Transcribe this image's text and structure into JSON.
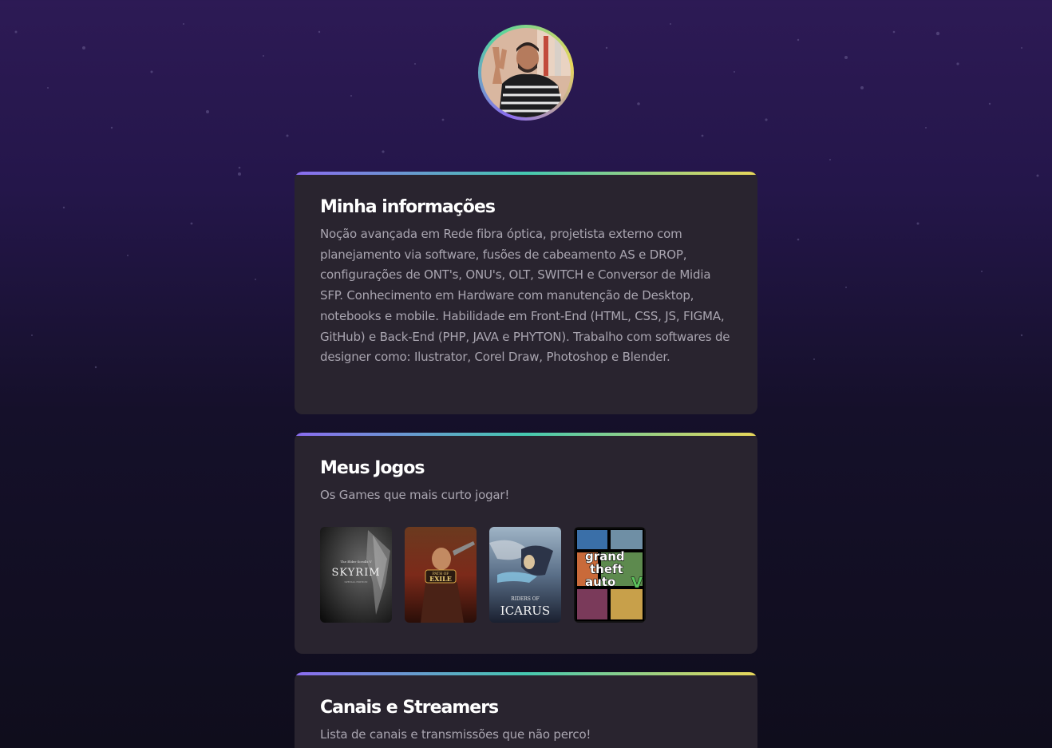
{
  "profile": {
    "avatar_icon": "profile-photo"
  },
  "info_card": {
    "title": "Minha informações",
    "text": "Noção avançada em Rede fibra óptica, projetista externo com planejamento via software, fusões de cabeamento AS e DROP, configurações de ONT's, ONU's, OLT, SWITCH e Conversor de Midia SFP. Conhecimento em Hardware com manutenção de Desktop, notebooks e mobile. Habilidade em Front-End (HTML, CSS, JS, FIGMA, GitHub) e Back-End (PHP, JAVA e PHYTON). Trabalho com softwares de designer como: Ilustrator, Corel Draw, Photoshop e Blender."
  },
  "games_card": {
    "title": "Meus Jogos",
    "subtitle": "Os Games que mais curto jogar!",
    "games": [
      {
        "name": "skyrim-cover",
        "line1": "The Elder Scrolls V",
        "line2": "SKYRIM",
        "line3": "SPECIAL EDITION"
      },
      {
        "name": "path-of-exile-cover",
        "line1": "PATH OF",
        "line2": "EXILE"
      },
      {
        "name": "riders-of-icarus-cover",
        "line1": "RIDERS OF",
        "line2": "ICARUS"
      },
      {
        "name": "gta-v-cover",
        "line1": "grand",
        "line2": "theft",
        "line3": "auto"
      }
    ]
  },
  "channels_card": {
    "title": "Canais e Streamers",
    "subtitle": "Lista de canais e transmissões que não perco!"
  },
  "colors": {
    "gradient_start": "#8b6cf0",
    "gradient_mid": "#45c9b0",
    "gradient_end": "#e8d75a",
    "card_bg": "#29242f"
  }
}
